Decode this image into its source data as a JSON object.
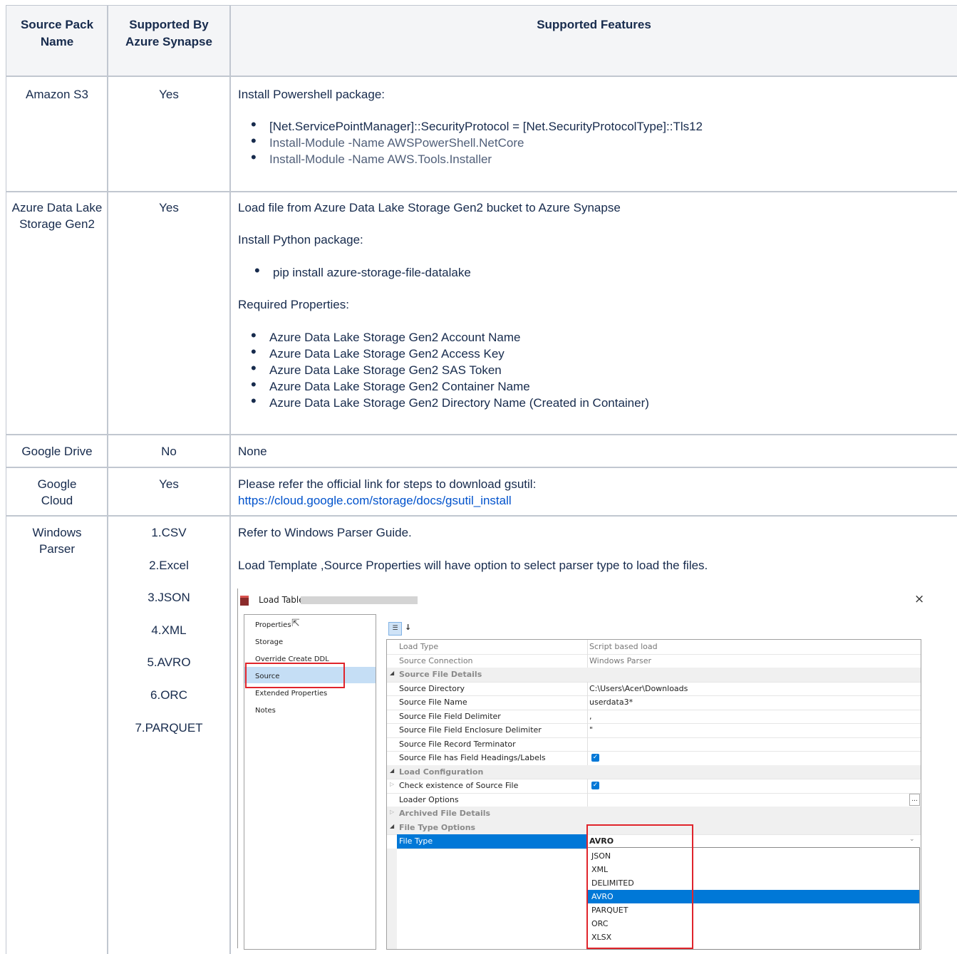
{
  "table": {
    "headers": {
      "source_pack": "Source Pack Name",
      "supported": "Supported By Azure Synapse",
      "features": "Supported Features"
    },
    "rows": [
      {
        "name": "Amazon S3",
        "supported": "Yes",
        "intro": "Install Powershell package:",
        "bullets": [
          "[Net.ServicePointManager]::SecurityProtocol = [Net.SecurityProtocolType]::Tls12",
          "Install-Module -Name AWSPowerShell.NetCore",
          "Install-Module -Name AWS.Tools.Installer"
        ]
      },
      {
        "name": "Azure Data Lake Storage Gen2",
        "supported": "Yes",
        "line1": "Load file from Azure Data Lake Storage Gen2 bucket to Azure Synapse",
        "line2": "Install Python package:",
        "bullet1": "pip install azure-storage-file-datalake",
        "line3": "Required Properties:",
        "bullets": [
          "Azure Data Lake Storage Gen2 Account Name",
          "Azure Data Lake Storage Gen2 Access Key",
          "Azure Data Lake Storage Gen2 SAS Token",
          "Azure Data Lake Storage Gen2 Container Name",
          "Azure Data Lake Storage Gen2 Directory Name (Created in Container)"
        ]
      },
      {
        "name": "Google Drive",
        "supported": "No",
        "text": "None"
      },
      {
        "name": "Google Cloud",
        "supported": "Yes",
        "text": "Please refer the official link for steps to download gsutil:",
        "link": "https://cloud.google.com/storage/docs/gsutil_install"
      },
      {
        "name": "Windows Parser",
        "supported_list": [
          "1.CSV",
          "2.Excel",
          "3.JSON",
          "4.XML",
          "5.AVRO",
          "6.ORC",
          "7.PARQUET"
        ],
        "line1": "Refer to Windows Parser Guide.",
        "line2": "Load Template ,Source Properties will have option to select parser type to load the files."
      }
    ]
  },
  "dialog": {
    "title": "Load Table",
    "close": "×",
    "nav": [
      "Properties",
      "Storage",
      "Override Create DDL",
      "Source",
      "Extended Properties",
      "Notes"
    ],
    "properties": [
      {
        "key": "Load Type",
        "value": "Script based load",
        "kind": "readonly"
      },
      {
        "key": "Source Connection",
        "value": "Windows Parser",
        "kind": "readonly"
      },
      {
        "key": "Source File Details",
        "kind": "category"
      },
      {
        "key": "Source Directory",
        "value": "C:\\Users\\Acer\\Downloads"
      },
      {
        "key": "Source File Name",
        "value": "userdata3*"
      },
      {
        "key": "Source File Field Delimiter",
        "value": ","
      },
      {
        "key": "Source File Field Enclosure Delimiter",
        "value": "\""
      },
      {
        "key": "Source File Record Terminator",
        "value": ""
      },
      {
        "key": "Source File has Field Headings/Labels",
        "checked": true
      },
      {
        "key": "Load Configuration",
        "kind": "category"
      },
      {
        "key": "Check existence of Source File",
        "checked": true
      },
      {
        "key": "Loader Options",
        "value": "",
        "ellipsis": "..."
      },
      {
        "key": "Archived File Details",
        "kind": "category"
      },
      {
        "key": "File Type Options",
        "kind": "category"
      },
      {
        "key": "File Type",
        "value": "AVRO",
        "kind": "selected"
      }
    ],
    "file_type_options": [
      "JSON",
      "XML",
      "DELIMITED",
      "AVRO",
      "PARQUET",
      "ORC",
      "XLSX"
    ],
    "file_type_selected": "AVRO"
  }
}
